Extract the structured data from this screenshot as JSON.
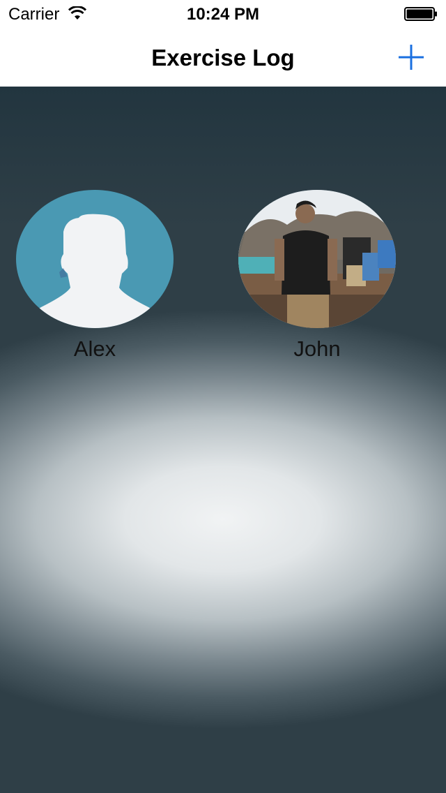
{
  "status_bar": {
    "carrier": "Carrier",
    "time": "10:24 PM",
    "wifi_icon": "wifi-icon",
    "battery_icon": "battery-full-icon"
  },
  "nav_bar": {
    "title": "Exercise Log",
    "add_icon": "plus-icon",
    "accent_color": "#1a6fe0"
  },
  "profiles": [
    {
      "name": "Alex",
      "avatar": "default-person-avatar",
      "avatar_bg": "#4a99b3"
    },
    {
      "name": "John",
      "avatar": "photo-avatar"
    }
  ]
}
